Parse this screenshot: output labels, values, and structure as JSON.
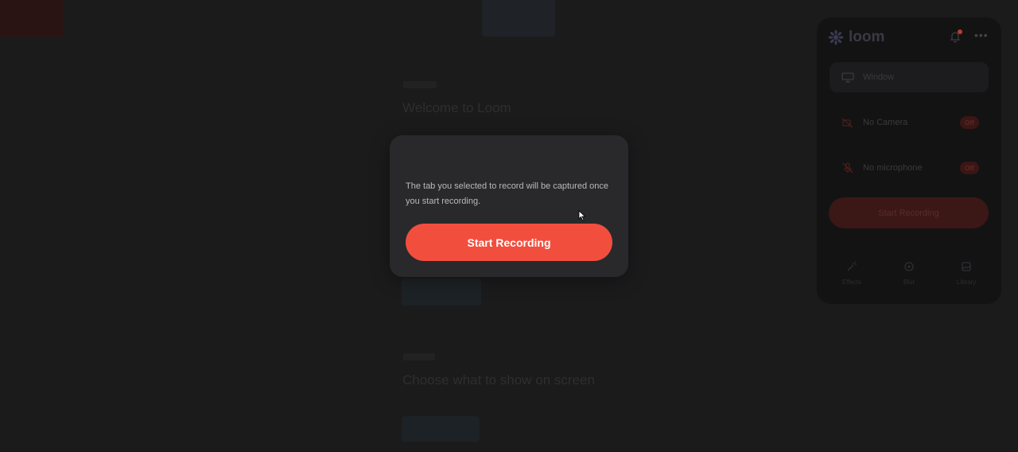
{
  "background_page": {
    "welcome_heading": "Welcome to Loom",
    "second_heading": "Choose what to show on screen"
  },
  "modal": {
    "message": "The tab you selected to record will be captured once you start recording.",
    "start_button": "Start Recording"
  },
  "loom_panel": {
    "logo_text": "loom",
    "source": {
      "label": "Window",
      "icon": "monitor-icon"
    },
    "camera": {
      "label": "No Camera",
      "state": "Off",
      "icon": "camera-off-icon"
    },
    "microphone": {
      "label": "No microphone",
      "state": "Off",
      "icon": "mic-off-icon"
    },
    "start_button": "Start Recording",
    "footer": [
      {
        "label": "Effects",
        "icon": "effects-icon"
      },
      {
        "label": "Blur",
        "icon": "blur-icon"
      },
      {
        "label": "Library",
        "icon": "library-icon"
      }
    ]
  },
  "colors": {
    "accent": "#f24e3e",
    "modal_bg": "#29292b",
    "page_bg": "#1b1b1c"
  }
}
